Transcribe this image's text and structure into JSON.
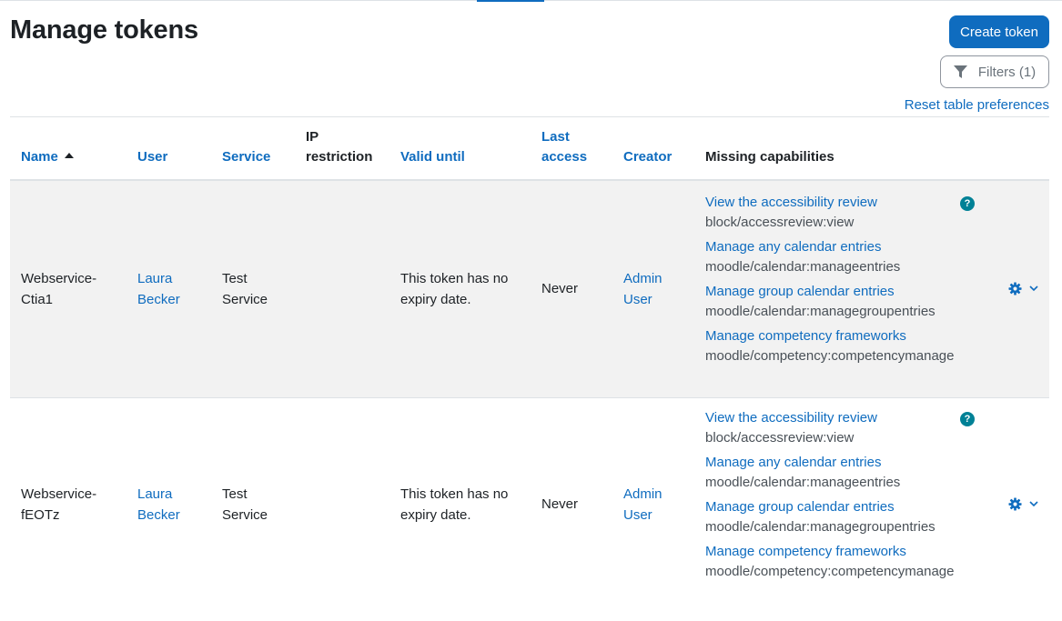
{
  "page": {
    "title": "Manage tokens",
    "create_button": "Create token",
    "filters_button": "Filters (1)",
    "reset_link": "Reset table preferences"
  },
  "table": {
    "headers": {
      "name": "Name",
      "user": "User",
      "service": "Service",
      "ip_restriction": "IP restriction",
      "valid_until": "Valid until",
      "last_access": "Last access",
      "creator": "Creator",
      "missing_capabilities": "Missing capabilities"
    },
    "rows": [
      {
        "name": "Webservice-Ctia1",
        "user": "Laura Becker",
        "service": "Test Service",
        "ip_restriction": "",
        "valid_until": "This token has no expiry date.",
        "last_access": "Never",
        "creator": "Admin User",
        "capabilities": [
          {
            "label": "View the accessibility review",
            "name": "block/accessreview:view"
          },
          {
            "label": "Manage any calendar entries",
            "name": "moodle/calendar:manageentries"
          },
          {
            "label": "Manage group calendar entries",
            "name": "moodle/calendar:managegroupentries"
          },
          {
            "label": "Manage competency frameworks",
            "name": "moodle/competency:competencymanage"
          }
        ]
      },
      {
        "name": "Webservice-fEOTz",
        "user": "Laura Becker",
        "service": "Test Service",
        "ip_restriction": "",
        "valid_until": "This token has no expiry date.",
        "last_access": "Never",
        "creator": "Admin User",
        "capabilities": [
          {
            "label": "View the accessibility review",
            "name": "block/accessreview:view"
          },
          {
            "label": "Manage any calendar entries",
            "name": "moodle/calendar:manageentries"
          },
          {
            "label": "Manage group calendar entries",
            "name": "moodle/calendar:managegroupentries"
          },
          {
            "label": "Manage competency frameworks",
            "name": "moodle/competency:competencymanage"
          }
        ]
      }
    ]
  },
  "colors": {
    "accent": "#0f6cbf",
    "help_icon": "#008196",
    "stripe": "#f2f2f2"
  },
  "icons": {
    "filter": "funnel-icon",
    "help": "question-circle-icon",
    "actions": "gear-icon",
    "dropdown": "chevron-down-icon"
  }
}
